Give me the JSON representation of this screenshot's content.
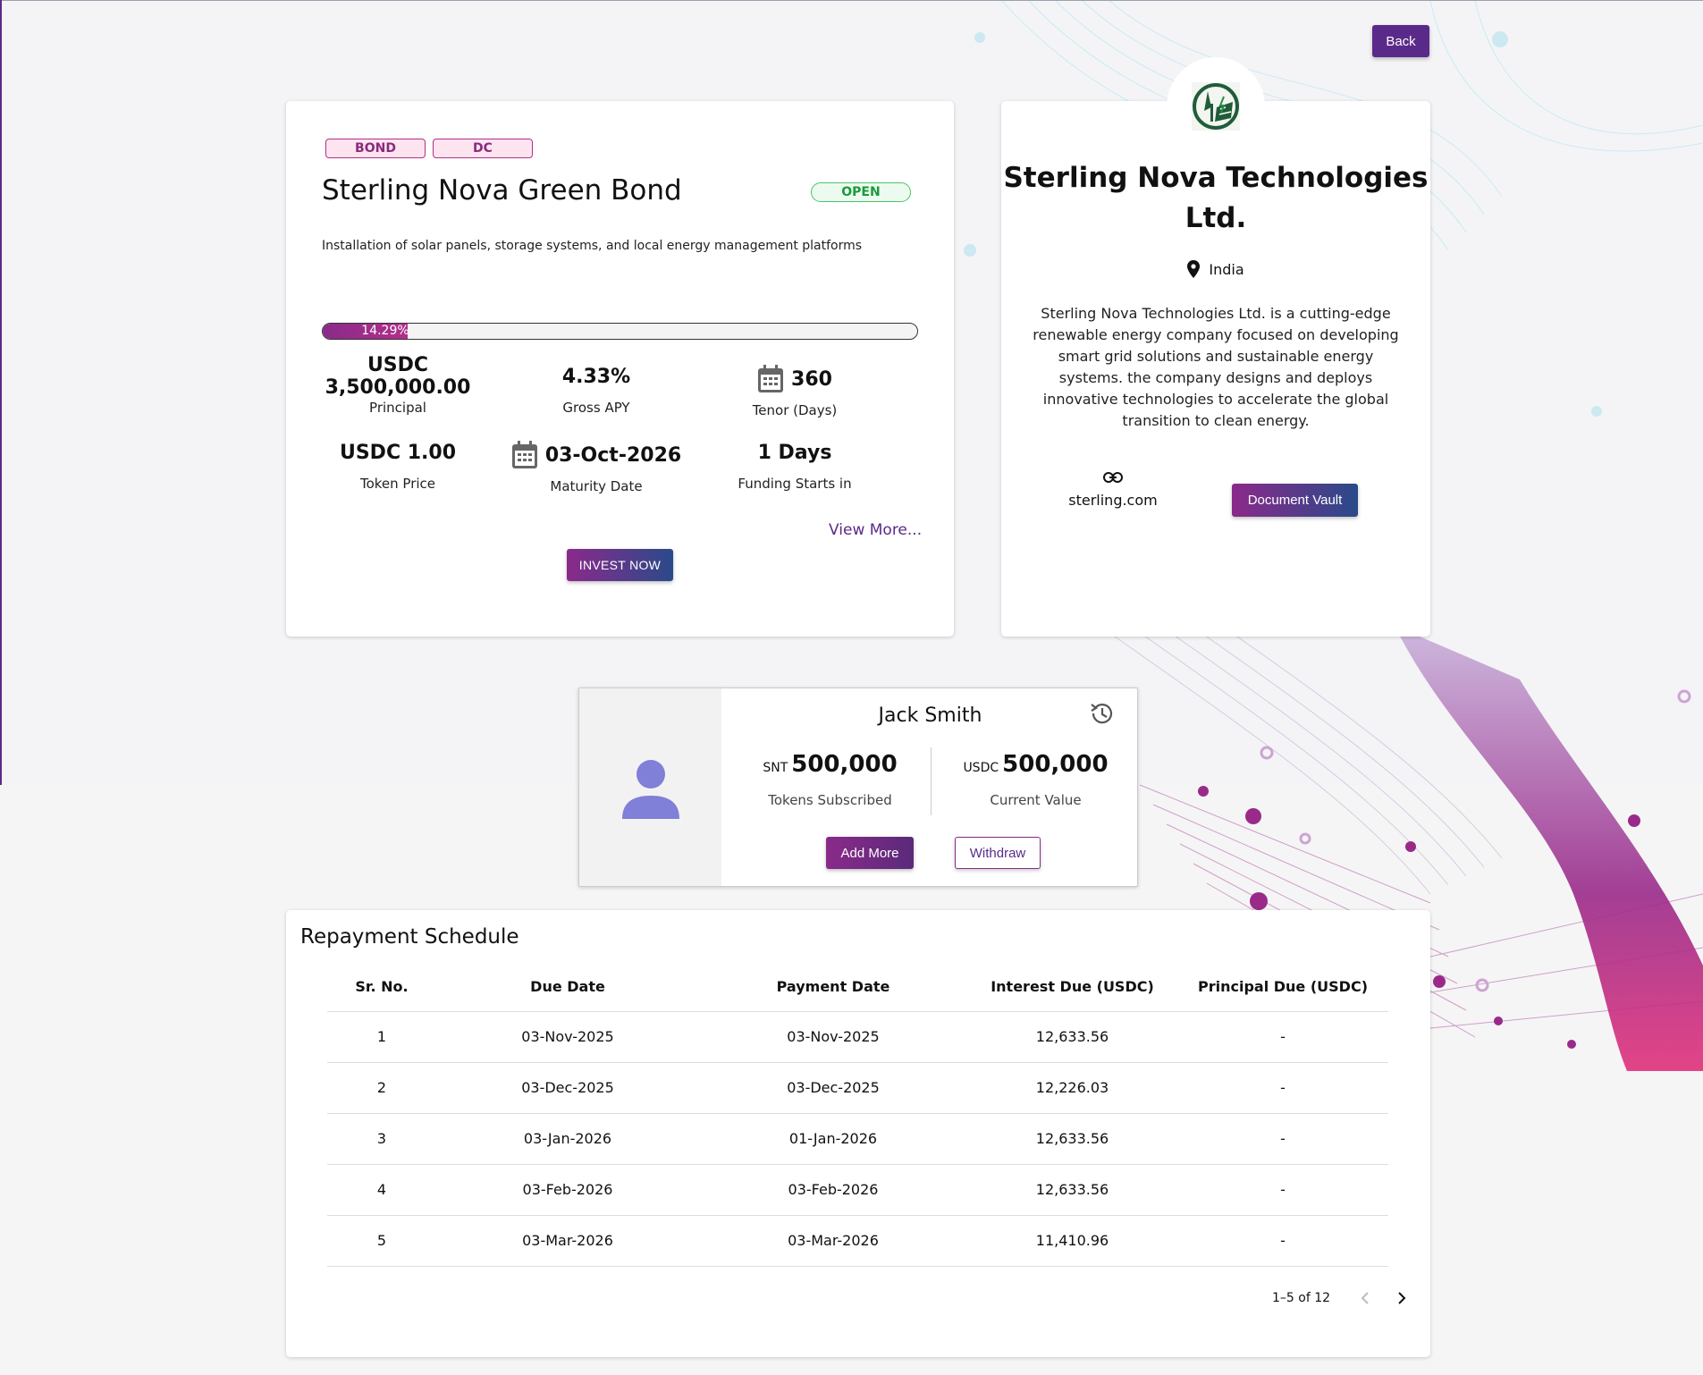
{
  "header": {
    "back_label": "Back"
  },
  "bond": {
    "tags": [
      "BOND",
      "DC"
    ],
    "title": "Sterling Nova Green Bond",
    "status": "OPEN",
    "description": "Installation of solar panels, storage systems, and local energy management platforms",
    "progress_label": "14.29%",
    "progress_fraction": 0.1429,
    "stats": {
      "principal_value": "USDC 3,500,000.00",
      "principal_label": "Principal",
      "apy_value": "4.33%",
      "apy_label": "Gross APY",
      "tenor_value": "360",
      "tenor_label": "Tenor (Days)",
      "token_price_value": "USDC 1.00",
      "token_price_label": "Token Price",
      "maturity_value": "03-Oct-2026",
      "maturity_label": "Maturity Date",
      "funding_value": "1 Days",
      "funding_label": "Funding Starts in"
    },
    "view_more": "View More...",
    "invest_label": "INVEST NOW"
  },
  "company": {
    "name": "Sterling Nova Technologies Ltd.",
    "location": "India",
    "description": "Sterling Nova Technologies Ltd. is a cutting-edge renewable energy company focused on developing smart grid solutions and sustainable energy systems. the company designs and deploys innovative technologies to accelerate the global transition to clean energy.",
    "website": "sterling.com",
    "vault_label": "Document Vault"
  },
  "investor": {
    "name": "Jack Smith",
    "tokens_currency": "SNT",
    "tokens_value": "500,000",
    "tokens_label": "Tokens Subscribed",
    "current_currency": "USDC",
    "current_value": "500,000",
    "current_label": "Current Value",
    "add_more_label": "Add More",
    "withdraw_label": "Withdraw"
  },
  "repayment": {
    "title": "Repayment Schedule",
    "columns": [
      "Sr. No.",
      "Due Date",
      "Payment Date",
      "Interest Due (USDC)",
      "Principal Due (USDC)"
    ],
    "rows": [
      [
        "1",
        "03-Nov-2025",
        "03-Nov-2025",
        "12,633.56",
        "-"
      ],
      [
        "2",
        "03-Dec-2025",
        "03-Dec-2025",
        "12,226.03",
        "-"
      ],
      [
        "3",
        "03-Jan-2026",
        "01-Jan-2026",
        "12,633.56",
        "-"
      ],
      [
        "4",
        "03-Feb-2026",
        "03-Feb-2026",
        "12,633.56",
        "-"
      ],
      [
        "5",
        "03-Mar-2026",
        "03-Mar-2026",
        "11,410.96",
        "-"
      ]
    ],
    "pagination": "1–5 of 12"
  },
  "icons": {
    "calendar": "calendar-icon",
    "location": "location-pin-icon",
    "link": "link-icon",
    "history": "history-icon",
    "avatar": "person-icon",
    "logo": "company-logo-icon"
  },
  "colors": {
    "brand_purple": "#5a2a8a",
    "accent_magenta": "#b0308a",
    "gradient_blue": "#2a4a8a",
    "open_green": "#1a9a3a"
  }
}
